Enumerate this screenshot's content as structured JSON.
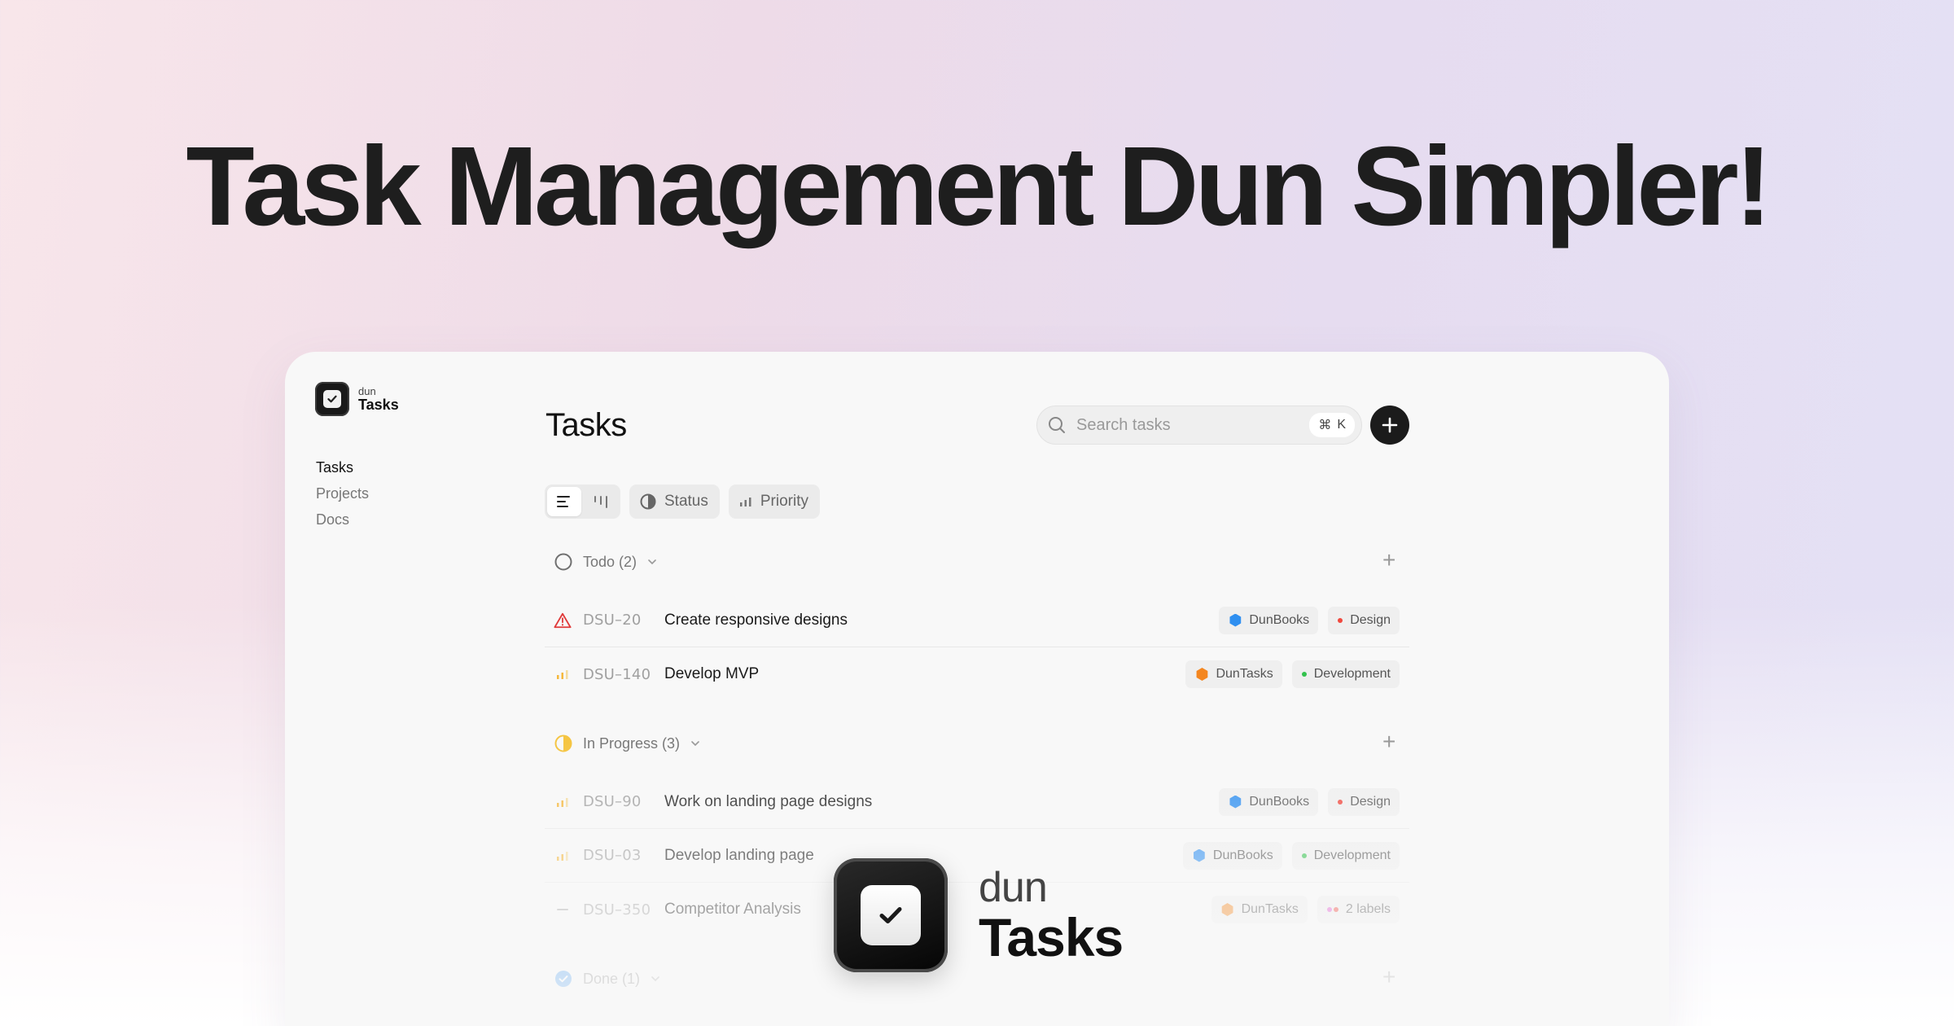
{
  "headline": "Task Management Dun Simpler!",
  "sidebar": {
    "logo_small": "dun",
    "logo_big": "Tasks",
    "items": [
      {
        "label": "Tasks",
        "active": true
      },
      {
        "label": "Projects",
        "active": false
      },
      {
        "label": "Docs",
        "active": false
      }
    ]
  },
  "main": {
    "title": "Tasks",
    "search": {
      "placeholder": "Search tasks",
      "shortcut_symbol": "⌘",
      "shortcut_key": "K"
    },
    "toolbar": {
      "status_label": "Status",
      "priority_label": "Priority"
    }
  },
  "groups": [
    {
      "label": "Todo (2)",
      "tasks": [
        {
          "id": "DSU–20",
          "title": "Create responsive designs",
          "priority": "urgent",
          "tags": [
            {
              "label": "DunBooks",
              "kind": "project",
              "color": "#2f8ff0"
            },
            {
              "label": "Design",
              "kind": "label",
              "color": "#f0483e"
            }
          ]
        },
        {
          "id": "DSU–140",
          "title": "Develop MVP",
          "priority": "medium",
          "tags": [
            {
              "label": "DunTasks",
              "kind": "project",
              "color": "#f4861f"
            },
            {
              "label": "Development",
              "kind": "label",
              "color": "#33c24d"
            }
          ]
        }
      ]
    },
    {
      "label": "In Progress (3)",
      "tasks": [
        {
          "id": "DSU–90",
          "title": "Work on landing page designs",
          "priority": "medium",
          "tags": [
            {
              "label": "DunBooks",
              "kind": "project",
              "color": "#2f8ff0"
            },
            {
              "label": "Design",
              "kind": "label",
              "color": "#f0483e"
            }
          ]
        },
        {
          "id": "DSU–03",
          "title": "Develop landing page",
          "priority": "medium",
          "tags": [
            {
              "label": "DunBooks",
              "kind": "project",
              "color": "#2f8ff0"
            },
            {
              "label": "Development",
              "kind": "label",
              "color": "#33c24d"
            }
          ]
        },
        {
          "id": "DSU–350",
          "title": "Competitor Analysis",
          "priority": "none",
          "tags": [
            {
              "label": "DunTasks",
              "kind": "project",
              "color": "#f4861f"
            },
            {
              "label": "2 labels",
              "kind": "multi",
              "color": "#e05bd0"
            }
          ]
        }
      ]
    },
    {
      "label": "Done (1)",
      "tasks": []
    }
  ],
  "brand": {
    "small": "dun",
    "big": "Tasks"
  },
  "colors": {
    "todo": "#707070",
    "in_progress": "#f5c542",
    "done": "#2f8ff0",
    "urgent": "#e03a3a",
    "priority_bars": "#f5b83d"
  }
}
